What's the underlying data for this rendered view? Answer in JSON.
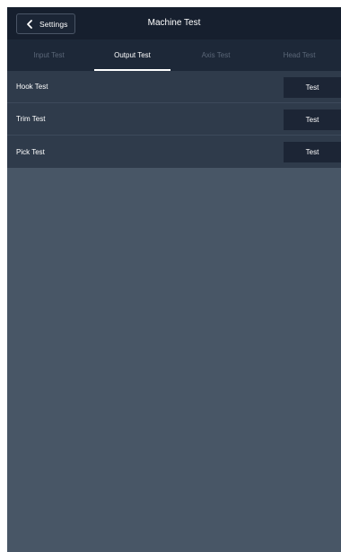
{
  "header": {
    "back_label": "Settings",
    "title": "Machine Test"
  },
  "tabs": [
    {
      "label": "Input Test",
      "active": false
    },
    {
      "label": "Output Test",
      "active": true
    },
    {
      "label": "Axis Test",
      "active": false
    },
    {
      "label": "Head Test",
      "active": false
    }
  ],
  "rows": [
    {
      "label": "Hook Test",
      "button": "Test"
    },
    {
      "label": "Trim Test",
      "button": "Test"
    },
    {
      "label": "Pick Test",
      "button": "Test"
    }
  ],
  "colors": {
    "background": "#485666",
    "header": "#161f2e",
    "tabbar": "#1d2838",
    "list": "#2f3b4b",
    "button": "#1c2535",
    "inactive_tab_text": "#5b6778"
  },
  "icons": {
    "back": "chevron-left-icon"
  }
}
